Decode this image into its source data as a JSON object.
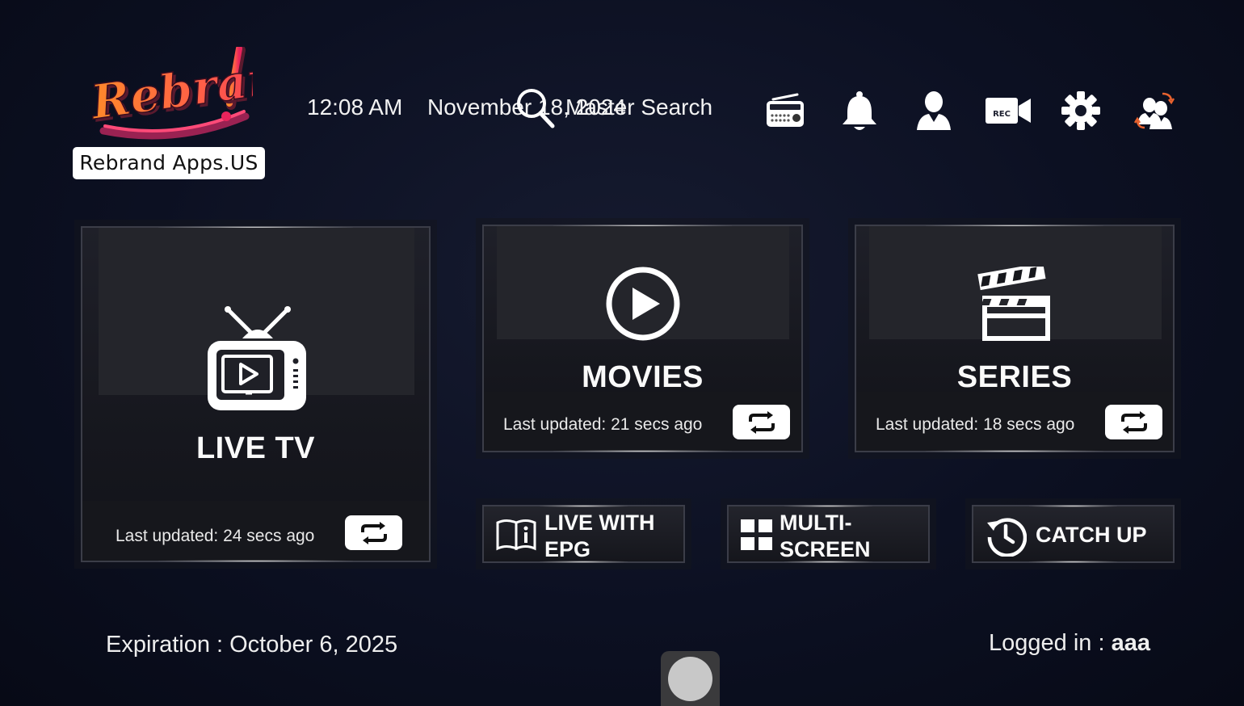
{
  "brand": {
    "logo_text": "Rebrand",
    "caption": "Rebrand Apps.US"
  },
  "header": {
    "time": "12:08 AM",
    "date": "November 18, 2024",
    "search_label": "Master Search",
    "icons": [
      "radio-icon",
      "bell-icon",
      "user-icon",
      "rec-camera-icon",
      "gear-icon",
      "switch-user-icon"
    ],
    "rec_text": "REC"
  },
  "tiles": {
    "live_tv": {
      "title": "LIVE TV",
      "updated": "Last updated: 24 secs ago"
    },
    "movies": {
      "title": "MOVIES",
      "updated": "Last updated: 21 secs ago"
    },
    "series": {
      "title": "SERIES",
      "updated": "Last updated: 18 secs ago"
    }
  },
  "small_tiles": {
    "live_epg": {
      "line1": "LIVE WITH",
      "line2": "EPG"
    },
    "multi_screen": {
      "line1": "MULTI-",
      "line2": "SCREEN"
    },
    "catch_up": {
      "label": "CATCH UP"
    }
  },
  "footer": {
    "expiration": "Expiration : October 6, 2025",
    "logged_in_label": "Logged in : ",
    "logged_in_user": "aaa"
  },
  "colors": {
    "background": "#0c1022",
    "logo_orange": "#ff7a2e",
    "logo_pink": "#e8245c",
    "tile_border": "#3b3d48"
  }
}
